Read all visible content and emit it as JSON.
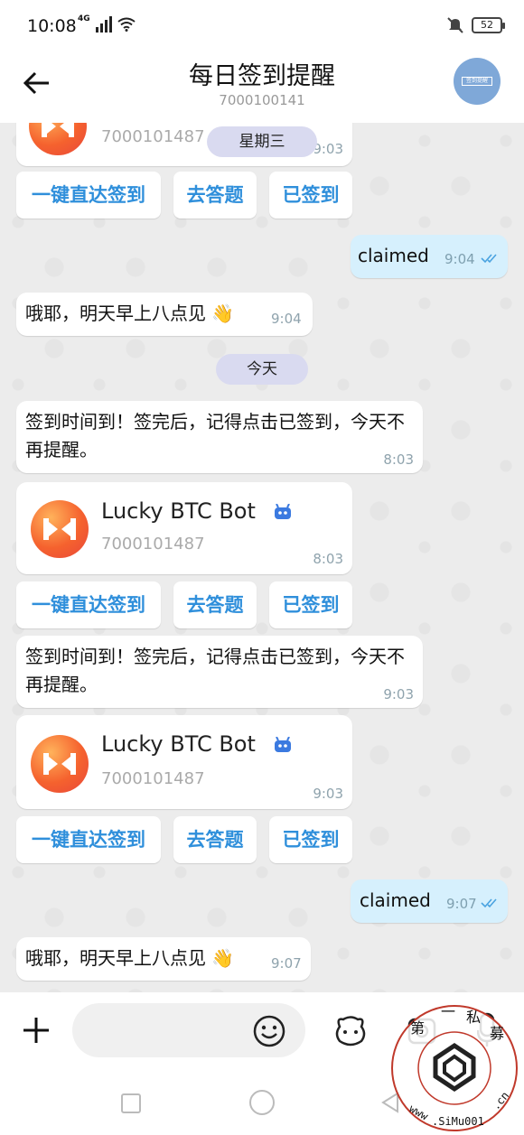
{
  "status": {
    "time": "10:08",
    "network": "4G",
    "battery": "52"
  },
  "header": {
    "title": "每日签到提醒",
    "subtitle": "7000100141",
    "avatar_text": "签到提醒"
  },
  "chat": {
    "top_partial": {
      "bot_id": "7000101487",
      "time": "9:03",
      "date_chip": "星期三",
      "buttons": [
        "一键直达签到",
        "去答题",
        "已签到"
      ]
    },
    "messages": [
      {
        "id": "m1",
        "dir": "out",
        "text": "claimed",
        "time": "9:04"
      },
      {
        "id": "m2",
        "dir": "in",
        "text": "哦耶，明天早上八点见 👋",
        "time": "9:04"
      },
      {
        "id": "d1",
        "type": "date",
        "text": "今天"
      },
      {
        "id": "m3",
        "dir": "in",
        "text": "签到时间到！签完后，记得点击已签到，今天不再提醒。",
        "time": "8:03"
      },
      {
        "id": "m4",
        "dir": "in",
        "type": "bot-card",
        "bot_name": "Lucky BTC Bot",
        "bot_id": "7000101487",
        "time": "8:03",
        "buttons": [
          "一键直达签到",
          "去答题",
          "已签到"
        ]
      },
      {
        "id": "m5",
        "dir": "in",
        "text": "签到时间到！签完后，记得点击已签到，今天不再提醒。",
        "time": "9:03"
      },
      {
        "id": "m6",
        "dir": "in",
        "type": "bot-card",
        "bot_name": "Lucky BTC Bot",
        "bot_id": "7000101487",
        "time": "9:03",
        "buttons": [
          "一键直达签到",
          "去答题",
          "已签到"
        ]
      },
      {
        "id": "m7",
        "dir": "out",
        "text": "claimed",
        "time": "9:07"
      },
      {
        "id": "m8",
        "dir": "in",
        "text": "哦耶，明天早上八点见 👋",
        "time": "9:07"
      }
    ]
  },
  "input": {
    "placeholder": ""
  },
  "watermark": {
    "top_text": "第一私募",
    "bottom_text": "www.SiMu001.cn"
  },
  "colors": {
    "accent": "#2f8fdb",
    "outgoing_bubble": "#d6f0fd",
    "date_chip": "#d9daf0",
    "chat_bg": "#ececec"
  }
}
